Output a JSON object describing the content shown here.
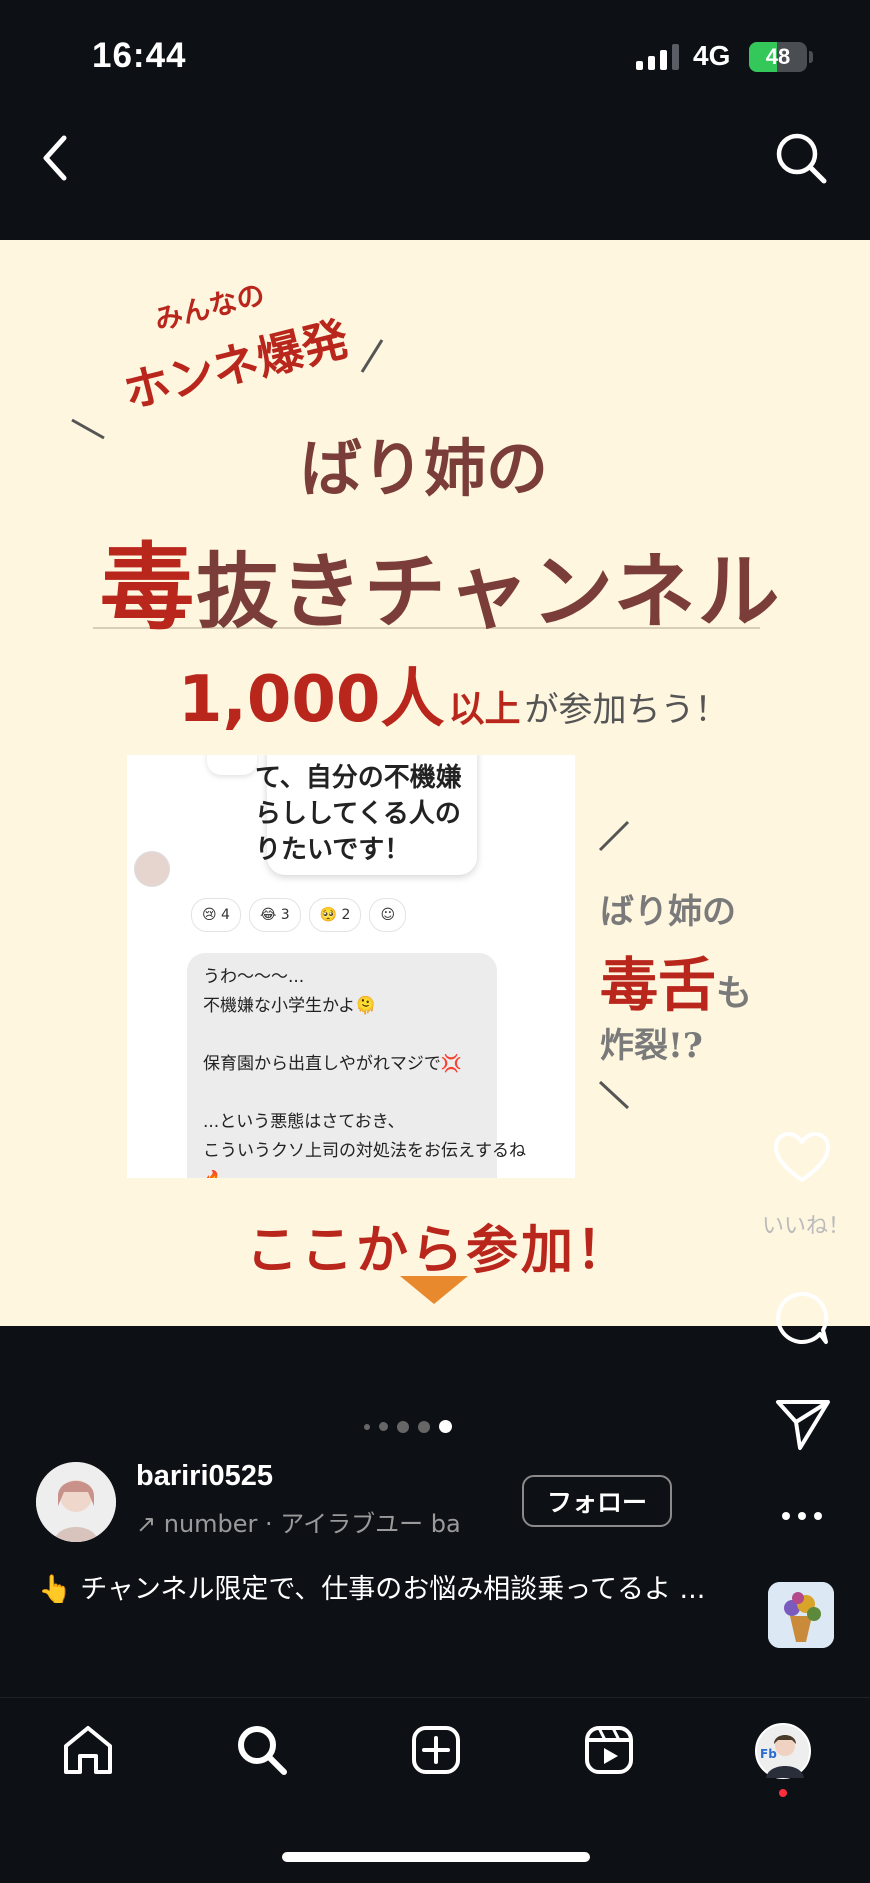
{
  "status_bar": {
    "time": "16:44",
    "network": "4G",
    "battery": "48",
    "battery_level": 0.48
  },
  "post_image": {
    "tag_line1": "みんなの",
    "tag_line2": "ホンネ爆発",
    "subtitle": "ばり姉の",
    "title_accent": "毒",
    "title_rest": "抜きチャンネル",
    "count_number": "1,000人",
    "count_ijo": "以上",
    "count_rest": "が参加ちう！",
    "screenshot_top_text": "て、自分の不機嫌\nらししてくる人の\nりたいです！",
    "reactions": [
      "😢 4",
      "😂 3",
      "🥺 2",
      "☺"
    ],
    "reply_text": "うわ〜〜〜...\n不機嫌な小学生かよ🫠\n\n保育園から出直しやがれマジで💢\n\n...という悪態はさておき、\nこういうクソ上司の対処法をお伝えするね\n🔥",
    "side_line1": "ばり姉の",
    "side_accent": "毒舌",
    "side_mo": "も",
    "side_line3": "炸裂!?",
    "cta": "ここから参加！"
  },
  "carousel": {
    "count": 5,
    "active_index": 4
  },
  "side_actions": {
    "like_label": "いいね！"
  },
  "author": {
    "username": "bariri0525",
    "music": "↗ number · アイラブユー    ba",
    "follow_label": "フォロー"
  },
  "caption": "👆 チャンネル限定で、仕事のお悩み相談乗ってるよ ...",
  "icons": {
    "back": "chevron-left-icon",
    "search": "search-icon",
    "heart": "heart-icon",
    "comment": "comment-icon",
    "share": "send-icon",
    "more": "more-icon",
    "home": "home-icon",
    "create": "plus-square-icon",
    "reels": "reels-icon"
  },
  "colors": {
    "accent_red": "#b9261c",
    "title_brown": "#7a3d3a",
    "cream": "#fef6df",
    "arrow_orange": "#e8892e"
  }
}
